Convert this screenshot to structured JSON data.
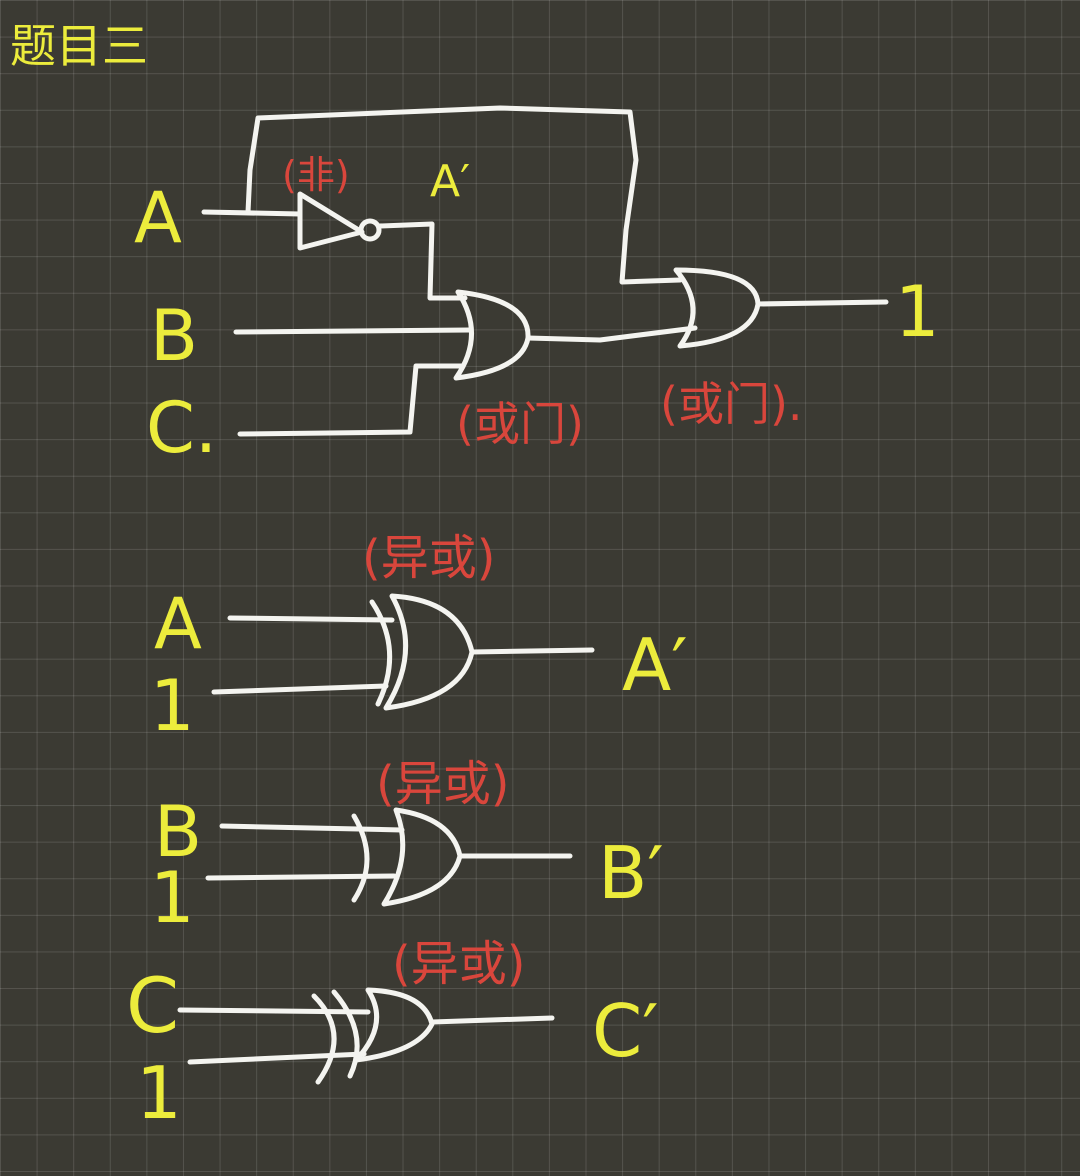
{
  "title": "题目三",
  "circuit1": {
    "inputs": {
      "a": "A",
      "b": "B",
      "c": "C."
    },
    "not_label": "(非)",
    "not_output": "A′",
    "or1_label": "(或门)",
    "or2_label": "(或门).",
    "output": "1"
  },
  "xor_circuits": [
    {
      "label": "(异或)",
      "input_top": "A",
      "input_bottom": "1",
      "output": "A′"
    },
    {
      "label": "(异或)",
      "input_top": "B",
      "input_bottom": "1",
      "output": "B′"
    },
    {
      "label": "(异或)",
      "input_top": "C",
      "input_bottom": "1",
      "output": "C′"
    }
  ],
  "colors": {
    "background": "#3b3a33",
    "wire": "#f4f4f0",
    "label_yellow": "#ecec3c",
    "label_red": "#d9463c"
  }
}
